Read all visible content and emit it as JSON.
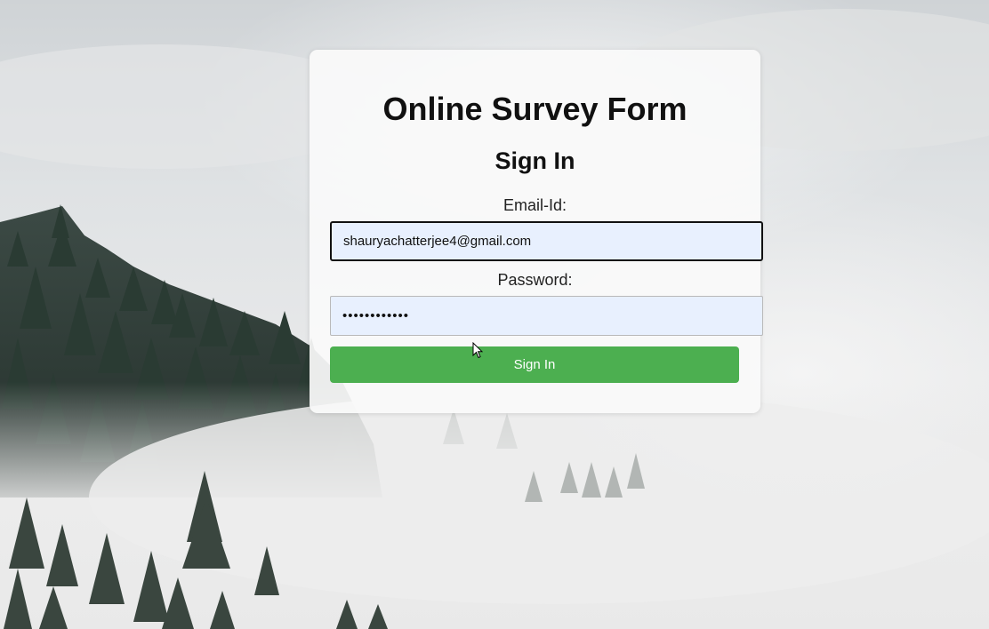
{
  "page": {
    "title": "Online Survey Form",
    "subtitle": "Sign In"
  },
  "form": {
    "email": {
      "label": "Email-Id:",
      "value": "shauryachatterjee4@gmail.com"
    },
    "password": {
      "label": "Password:",
      "value": "••••••••••••"
    },
    "submit_label": "Sign In"
  },
  "colors": {
    "submit_button": "#4caf50",
    "input_background": "#e8f0fe"
  }
}
